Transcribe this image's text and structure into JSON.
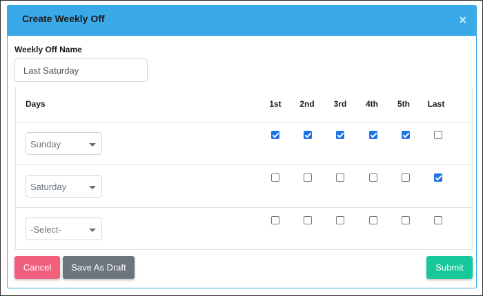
{
  "modal": {
    "title": "Create Weekly Off",
    "close_glyph": "×"
  },
  "form": {
    "name_label": "Weekly Off Name",
    "name_value": "Last Saturday"
  },
  "table": {
    "headers": {
      "days": "Days",
      "weeks": [
        "1st",
        "2nd",
        "3rd",
        "4th",
        "5th",
        "Last"
      ]
    },
    "rows": [
      {
        "day": "Sunday",
        "checks": [
          true,
          true,
          true,
          true,
          true,
          false
        ]
      },
      {
        "day": "Saturday",
        "checks": [
          false,
          false,
          false,
          false,
          false,
          true
        ]
      },
      {
        "day": "-Select-",
        "checks": [
          false,
          false,
          false,
          false,
          false,
          false
        ]
      }
    ]
  },
  "buttons": {
    "cancel": "Cancel",
    "draft": "Save As Draft",
    "submit": "Submit"
  },
  "colors": {
    "header": "#3aa9e8",
    "checkbox_checked": "#1a73e8",
    "cancel": "#f25f7c",
    "draft": "#6c757d",
    "submit": "#17c99a"
  },
  "icons": {
    "close": "close-icon",
    "dropdown": "chevron-down-icon"
  }
}
